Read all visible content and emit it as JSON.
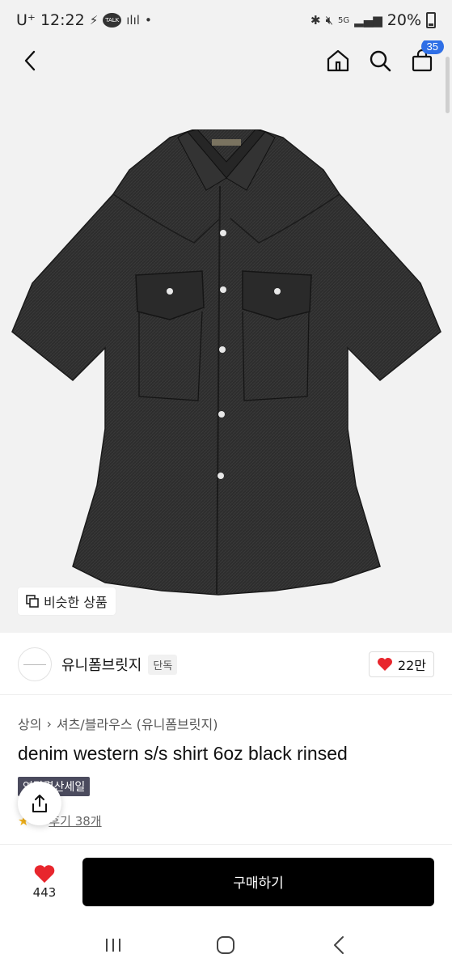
{
  "status_bar": {
    "carrier": "U⁺",
    "time": "12:22",
    "talk_label": "TALK",
    "signal_label": "5G",
    "battery": "20%"
  },
  "nav": {
    "cart_count": "35"
  },
  "image": {
    "similar_label": "비슷한 상품"
  },
  "brand": {
    "name": "유니폼브릿지",
    "tag": "단독",
    "likes": "22만"
  },
  "product": {
    "category_main": "상의",
    "category_sub": "셔츠/블라우스 (유니폼브릿지)",
    "title": "denim western s/s shirt 6oz black rinsed",
    "sale_badge": "연말결산세일",
    "review_text": "후기 38개"
  },
  "purchase": {
    "wish_count": "443",
    "buy_label": "구매하기"
  },
  "colors": {
    "accent_badge": "#2f6fe6",
    "heart": "#e8262d",
    "buy_button": "#000000"
  }
}
